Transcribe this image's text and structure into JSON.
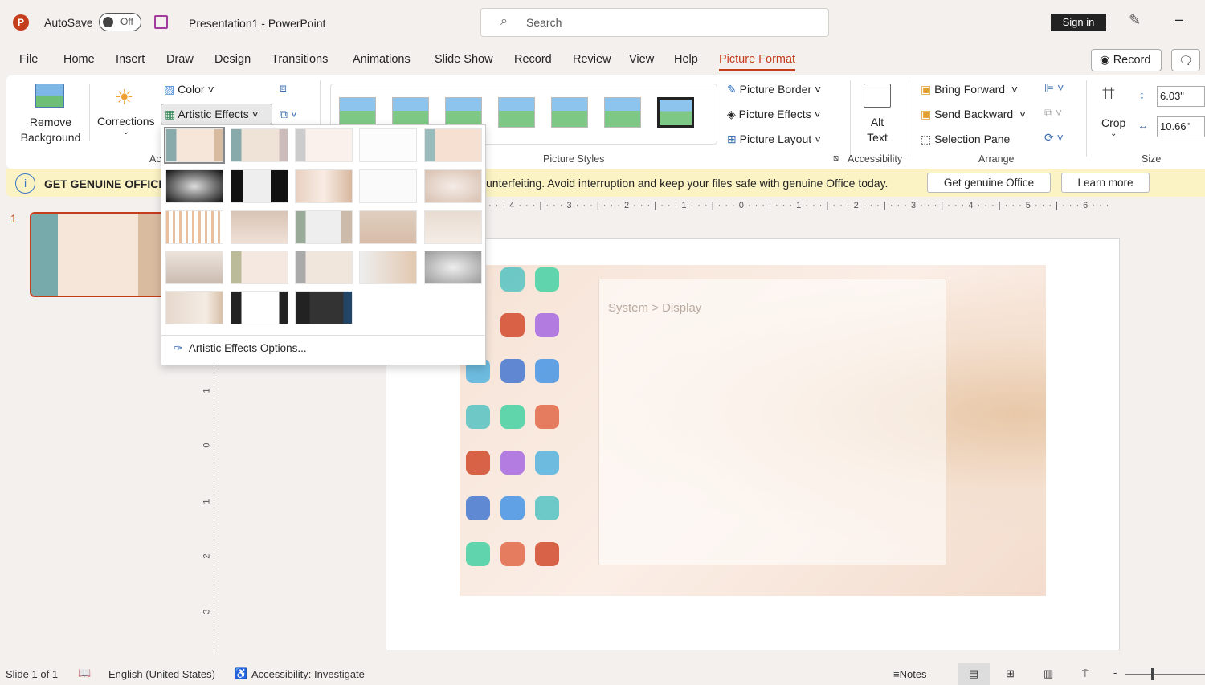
{
  "titlebar": {
    "autosave_label": "AutoSave",
    "autosave_state": "Off",
    "title": "Presentation1  -  PowerPoint",
    "search_placeholder": "Search",
    "sign_in": "Sign in"
  },
  "tabs": [
    "File",
    "Home",
    "Insert",
    "Draw",
    "Design",
    "Transitions",
    "Animations",
    "Slide Show",
    "Record",
    "Review",
    "View",
    "Help",
    "Picture Format"
  ],
  "active_tab": "Picture Format",
  "header_buttons": {
    "record": "Record"
  },
  "ribbon": {
    "remove_background": [
      "Remove",
      "Background"
    ],
    "corrections": "Corrections",
    "color": "Color",
    "artistic_effects": "Artistic Effects",
    "adjust_group": "Ac",
    "picture_styles_group": "Picture Styles",
    "picture_border": "Picture Border",
    "picture_effects": "Picture Effects",
    "picture_layout": "Picture Layout",
    "alt_text": [
      "Alt",
      "Text"
    ],
    "accessibility_group": "Accessibility",
    "bring_forward": "Bring Forward",
    "send_backward": "Send Backward",
    "selection_pane": "Selection Pane",
    "arrange_group": "Arrange",
    "crop": "Crop",
    "height": "6.03\"",
    "width": "10.66\"",
    "size_group": "Size"
  },
  "banner": {
    "title": "GET GENUINE OFFICE",
    "message": "unterfeiting. Avoid interruption and keep your files safe with genuine Office today.",
    "get_button": "Get genuine Office",
    "learn_button": "Learn more"
  },
  "dropdown": {
    "options_label": "Artistic Effects Options...",
    "effects_count": 23
  },
  "ruler": {
    "horizontal": "· · · 4 · · · | · · · 3 · · · | · · · 2 · · · | · · · 1 · · · | · · · 0 · · · | · · · 1 · · · | · · · 2 · · · | · · · 3 · · · | · · · 4 · · · | · · · 5 · · · | · · · 6 · · ·",
    "vertical": [
      "1",
      "0",
      "1",
      "2",
      "3"
    ]
  },
  "slides": {
    "number": "1"
  },
  "slide_content": {
    "breadcrumb": "System  >  Display"
  },
  "status": {
    "slide": "Slide 1 of 1",
    "language": "English (United States)",
    "accessibility": "Accessibility: Investigate",
    "notes": "Notes"
  },
  "colors": {
    "accent": "#c43e1c",
    "banner": "#fbf3c4"
  }
}
